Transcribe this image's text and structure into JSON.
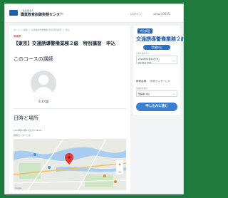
{
  "header": {
    "logo_sub": "一般社団法人",
    "logo_main": "職業教育訓練実務センター",
    "nav": [
      "ログイン",
      "sakura0655"
    ]
  },
  "main": {
    "breadcrumb": "ホーム ＞ 講座 ＞ 交通誘導警備業務２級 特別講習 ＞ 申込",
    "category": "警備業",
    "title": "【東京】交通誘導警備業務２級　特別講習　申込",
    "instructor_heading": "このコースの講師",
    "instructor_name": "SLKX講",
    "schedule_heading": "日時と場所",
    "schedule_date": "2026年03月21日(木) 09:00 -",
    "schedule_place": "研修センターにか",
    "map_footer": "Google"
  },
  "sidebar": {
    "badge": "特別講習",
    "title": "交通誘導警備業務２級",
    "status": "受講申込",
    "date_label": "日程を選択する",
    "date_value_line1": "2026年03月21日(木)",
    "date_value_line2": "09:00-17:00",
    "chevron": "⌄",
    "price_label": "研修会場",
    "price_value": "研修センターにか",
    "seat_label": "受講者を選択",
    "seat_value": "受講者(1名)",
    "apply_label": "申し込みに進む"
  }
}
